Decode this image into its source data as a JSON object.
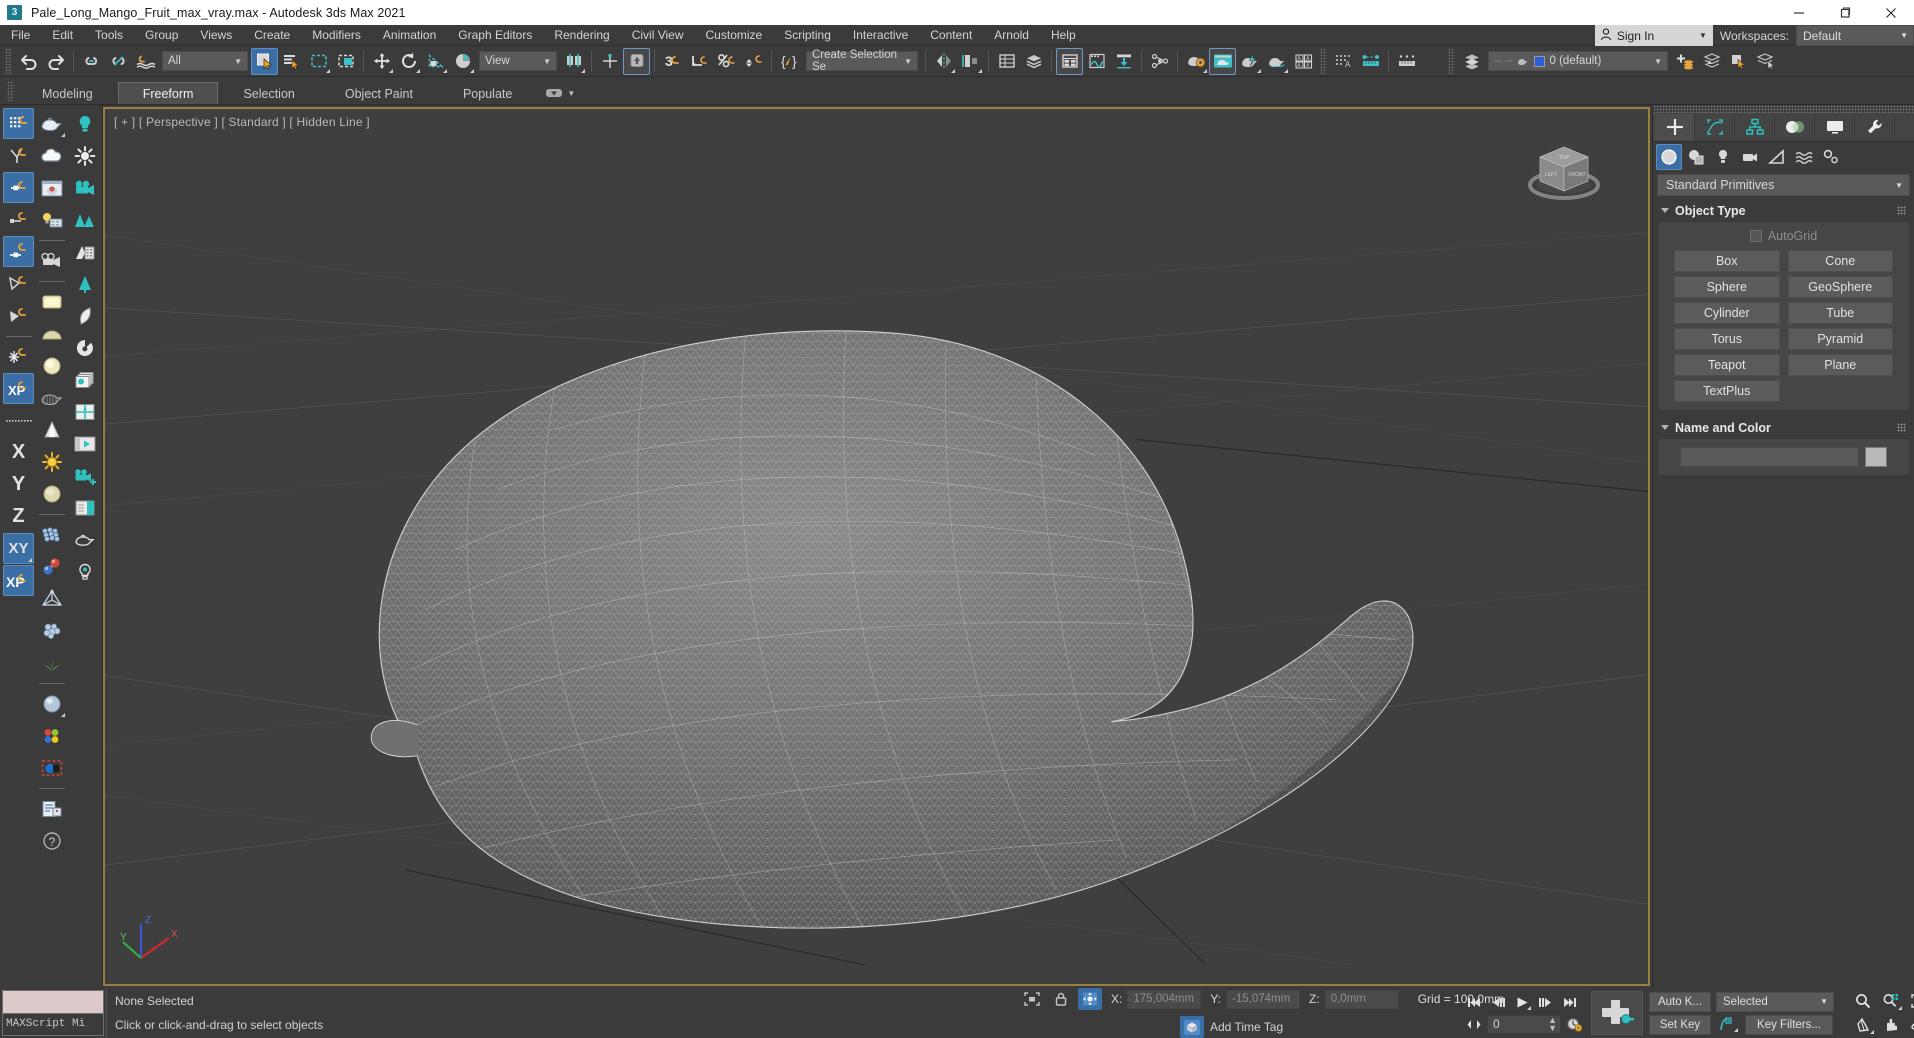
{
  "window": {
    "title": "Pale_Long_Mango_Fruit_max_vray.max - Autodesk 3ds Max 2021",
    "app_icon": "3",
    "minimize": "—",
    "maximize": "❐",
    "close": "×"
  },
  "menubar": {
    "items": [
      {
        "label": "File"
      },
      {
        "label": "Edit"
      },
      {
        "label": "Tools"
      },
      {
        "label": "Group"
      },
      {
        "label": "Views"
      },
      {
        "label": "Create"
      },
      {
        "label": "Modifiers"
      },
      {
        "label": "Animation"
      },
      {
        "label": "Graph Editors"
      },
      {
        "label": "Rendering"
      },
      {
        "label": "Civil View"
      },
      {
        "label": "Customize"
      },
      {
        "label": "Scripting"
      },
      {
        "label": "Interactive"
      },
      {
        "label": "Content"
      },
      {
        "label": "Arnold"
      },
      {
        "label": "Help"
      }
    ],
    "signin_label": "Sign In",
    "workspaces_label": "Workspaces:",
    "workspace_value": "Default"
  },
  "toolbar": {
    "undo": "undo-icon",
    "redo": "redo-icon",
    "select_filter_value": "All",
    "reference_coord_value": "View",
    "named_selection_set_value": "Create Selection Se",
    "layer_value": "0 (default)",
    "tooltips": {
      "undo": "Undo",
      "redo": "Redo",
      "select_and_link": "Select and Link",
      "unlink": "Unlink Selection",
      "bind_space_warp": "Bind to Space Warp",
      "select_object": "Select Object",
      "select_by_name": "Select by Name",
      "rect_select": "Rectangular Selection Region",
      "window_crossing": "Window/Crossing",
      "select_move": "Select and Move",
      "select_rotate": "Select and Rotate",
      "select_scale": "Select and Uniform Scale",
      "select_place": "Select and Place",
      "use_center": "Use Pivot Point Center",
      "snap_toggle": "Snaps Toggle",
      "angle_snap": "Angle Snap Toggle",
      "percent_snap": "Percent Snap Toggle",
      "spinner_snap": "Spinner Snap Toggle",
      "mirror": "Mirror",
      "align": "Align",
      "layer_explorer": "Layer Explorer",
      "scene_explorer": "Scene Explorer",
      "curve_editor": "Curve Editor",
      "schematic_view": "Schematic View",
      "material_editor": "Material Editor",
      "render_setup": "Render Setup",
      "render_frame": "Rendered Frame Window",
      "render_production": "Render Production"
    }
  },
  "ribbon": {
    "tabs": [
      {
        "label": "Modeling",
        "active": false
      },
      {
        "label": "Freeform",
        "active": true
      },
      {
        "label": "Selection",
        "active": false
      },
      {
        "label": "Object Paint",
        "active": false
      },
      {
        "label": "Populate",
        "active": false
      }
    ]
  },
  "viewport": {
    "label": "[ + ] [ Perspective ] [ Standard ] [ Hidden Line ]",
    "axis": {
      "x": "X",
      "y": "Y",
      "z": "Z"
    },
    "viewcube": {
      "top": "TOP",
      "left": "LEFT",
      "front": "FRONT"
    },
    "border_color": "#9a8040",
    "background_color": "#3f3f3f"
  },
  "left_toolbar": {
    "column1": [
      {
        "name": "snaps-grid-icon",
        "on": true
      },
      {
        "name": "snaps-vertex-icon",
        "on": false
      },
      {
        "name": "snaps-midpoint-icon",
        "on": true
      },
      {
        "name": "snaps-edge-icon",
        "on": false
      },
      {
        "name": "snaps-endpoint-icon",
        "on": true
      },
      {
        "name": "snaps-face-icon",
        "on": false
      },
      {
        "name": "snaps-pivot-icon",
        "on": false
      },
      {
        "name": "snaps-freeze-icon",
        "on": false
      },
      {
        "name": "snaps-xy-icon",
        "on": true
      },
      {
        "name": "axis-constraint-x",
        "label": "X"
      },
      {
        "name": "axis-constraint-y",
        "label": "Y"
      },
      {
        "name": "axis-constraint-z",
        "label": "Z"
      },
      {
        "name": "axis-constraint-xy",
        "label": "XY",
        "on": true
      },
      {
        "name": "axis-constraint-xp",
        "label": "XP",
        "on": true
      }
    ],
    "column2": [
      {
        "name": "teapot-icon"
      },
      {
        "name": "cloud-icon"
      },
      {
        "name": "render-preview-icon"
      },
      {
        "name": "light-setup-icon"
      },
      {
        "name": "camera-icon"
      },
      {
        "name": "area-light-icon"
      },
      {
        "name": "dome-light-icon"
      },
      {
        "name": "sphere-light-icon"
      },
      {
        "name": "wire-teapot-icon"
      },
      {
        "name": "cone-light-icon"
      },
      {
        "name": "sun-icon"
      },
      {
        "name": "sky-dome-icon"
      },
      {
        "name": "chain-links-icon"
      },
      {
        "name": "molecule-icon"
      },
      {
        "name": "explode-icon"
      },
      {
        "name": "particles-icon"
      },
      {
        "name": "grass-icon"
      },
      {
        "name": "material-sphere-icon"
      },
      {
        "name": "color-swatches-icon"
      },
      {
        "name": "blend-material-icon"
      },
      {
        "name": "report-icon"
      },
      {
        "name": "help-icon"
      }
    ],
    "column3": [
      {
        "name": "bulb-icon"
      },
      {
        "name": "sun-light-icon"
      },
      {
        "name": "video-camera-icon"
      },
      {
        "name": "trees-icon"
      },
      {
        "name": "building-icon"
      },
      {
        "name": "pine-tree-icon"
      },
      {
        "name": "leaf-icon"
      },
      {
        "name": "ring-icon"
      },
      {
        "name": "layers-stack-icon"
      },
      {
        "name": "crosshair-frame-icon"
      },
      {
        "name": "play-panel-icon"
      },
      {
        "name": "add-camera-icon"
      },
      {
        "name": "panel-icon"
      },
      {
        "name": "teapot-outline-icon"
      },
      {
        "name": "bulb-outline-icon"
      }
    ]
  },
  "command_panel": {
    "tabs": [
      {
        "name": "create-tab",
        "icon": "plus-icon",
        "active": true
      },
      {
        "name": "modify-tab",
        "icon": "modify-icon",
        "active": false
      },
      {
        "name": "hierarchy-tab",
        "icon": "hierarchy-icon",
        "active": false
      },
      {
        "name": "motion-tab",
        "icon": "motion-icon",
        "active": false
      },
      {
        "name": "display-tab",
        "icon": "display-icon",
        "active": false
      },
      {
        "name": "utilities-tab",
        "icon": "wrench-icon",
        "active": false
      }
    ],
    "subtabs": [
      {
        "name": "geometry-subtab",
        "icon": "sphere-icon",
        "active": true
      },
      {
        "name": "shapes-subtab",
        "icon": "shapes-icon",
        "active": false
      },
      {
        "name": "lights-subtab",
        "icon": "bulb-icon",
        "active": false
      },
      {
        "name": "cameras-subtab",
        "icon": "camera-icon",
        "active": false
      },
      {
        "name": "helpers-subtab",
        "icon": "triangle-ruler-icon",
        "active": false
      },
      {
        "name": "space-warps-subtab",
        "icon": "waves-icon",
        "active": false
      },
      {
        "name": "systems-subtab",
        "icon": "gears-icon",
        "active": false
      }
    ],
    "category_value": "Standard Primitives",
    "object_type": {
      "title": "Object Type",
      "autogrid_label": "AutoGrid",
      "autogrid_checked": false,
      "buttons": [
        "Box",
        "Cone",
        "Sphere",
        "GeoSphere",
        "Cylinder",
        "Tube",
        "Torus",
        "Pyramid",
        "Teapot",
        "Plane",
        "TextPlus"
      ]
    },
    "name_and_color": {
      "title": "Name and Color",
      "name_value": "",
      "name_placeholder": "",
      "color": "#b9b9b9"
    }
  },
  "status_bar": {
    "maxscript_label": "MAXScript Mi",
    "selection_status": "None Selected",
    "prompt": "Click or click-and-drag to select objects",
    "coords": {
      "x_label": "X:",
      "x_value": "175,004mm",
      "y_label": "Y:",
      "y_value": "-15,074mm",
      "z_label": "Z:",
      "z_value": "0,0mm"
    },
    "grid_text": "Grid = 100,0mm",
    "add_time_tag": "Add Time Tag"
  },
  "animation_bar": {
    "frame_value": "0",
    "auto_key": "Auto K...",
    "set_key": "Set Key",
    "key_filters": "Key Filters...",
    "selected_value": "Selected",
    "playback": [
      {
        "name": "go-to-start-button",
        "glyph": "⏮"
      },
      {
        "name": "previous-frame-button",
        "glyph": "⏪"
      },
      {
        "name": "play-button",
        "glyph": "▶"
      },
      {
        "name": "next-frame-button",
        "glyph": "⏩"
      },
      {
        "name": "go-to-end-button",
        "glyph": "⏭"
      }
    ],
    "nav_buttons": [
      {
        "name": "zoom-button",
        "icon": "magnifier-icon"
      },
      {
        "name": "zoom-all-button",
        "icon": "magnifier-all-icon"
      },
      {
        "name": "zoom-extents-button",
        "icon": "zoom-extents-icon"
      },
      {
        "name": "field-of-view-button",
        "icon": "fov-icon"
      },
      {
        "name": "pan-view-button",
        "icon": "hand-icon"
      },
      {
        "name": "orbit-button",
        "icon": "orbit-icon"
      },
      {
        "name": "maximize-viewport-button",
        "icon": "maximize-icon"
      },
      {
        "name": "zoom-region-button",
        "icon": "zoom-region-icon"
      }
    ]
  }
}
